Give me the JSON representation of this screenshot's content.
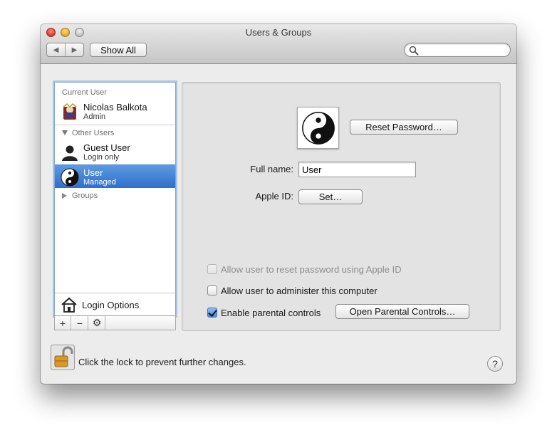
{
  "window": {
    "title": "Users & Groups",
    "show_all_label": "Show All",
    "back_glyph": "◀",
    "forward_glyph": "▶"
  },
  "search": {
    "value": "",
    "placeholder": ""
  },
  "sidebar": {
    "current_user_heading": "Current User",
    "current_user": {
      "name": "Nicolas Balkota",
      "role": "Admin"
    },
    "other_users_heading": "Other Users",
    "other_users": [
      {
        "name": "Guest User",
        "role": "Login only"
      },
      {
        "name": "User",
        "role": "Managed",
        "selected": true
      }
    ],
    "groups_heading": "Groups",
    "login_options_label": "Login Options",
    "add_glyph": "+",
    "remove_glyph": "−",
    "gear_glyph": "⚙"
  },
  "detail": {
    "reset_password_label": "Reset Password…",
    "full_name_label": "Full name:",
    "full_name_value": "User",
    "apple_id_label": "Apple ID:",
    "set_label": "Set…",
    "allow_reset_label": "Allow user to reset password using Apple ID",
    "allow_reset_checked": false,
    "allow_reset_enabled": false,
    "allow_admin_label": "Allow user to administer this computer",
    "allow_admin_checked": false,
    "parental_label": "Enable parental controls",
    "parental_checked": true,
    "open_parental_label": "Open Parental Controls…"
  },
  "footer": {
    "lock_text": "Click the lock to prevent further changes.",
    "help_glyph": "?"
  }
}
